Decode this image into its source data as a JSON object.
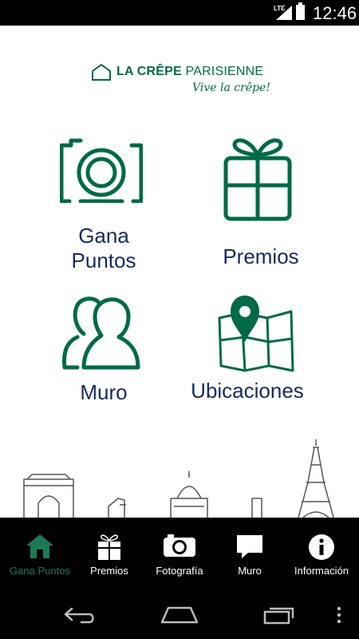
{
  "status_bar": {
    "network": "LTE",
    "time": "12:46",
    "icons": [
      "signal-icon",
      "battery-icon"
    ]
  },
  "logo": {
    "brand_bold": "LA CRÊPE",
    "brand_light": " PARISIENNE",
    "tagline": "Vive la crêpe!"
  },
  "tiles": {
    "gana": {
      "line1": "Gana",
      "line2": "Puntos",
      "icon": "camera-icon"
    },
    "premios": {
      "label": "Premios",
      "icon": "gift-icon"
    },
    "muro": {
      "label": "Muro",
      "icon": "users-icon"
    },
    "ubicaciones": {
      "label": "Ubicaciones",
      "icon": "map-pin-icon"
    }
  },
  "tab_bar": {
    "tabs": [
      {
        "label": "Gana Puntos",
        "icon": "home-icon",
        "active": true
      },
      {
        "label": "Premios",
        "icon": "gift-icon",
        "active": false
      },
      {
        "label": "Fotografía",
        "icon": "camera-icon",
        "active": false
      },
      {
        "label": "Muro",
        "icon": "chat-bubble-icon",
        "active": false
      },
      {
        "label": "Información",
        "icon": "info-icon",
        "active": false
      }
    ]
  },
  "nav_bar": {
    "buttons": [
      "back-icon",
      "home-icon",
      "recents-icon",
      "overflow-menu-icon"
    ]
  },
  "colors": {
    "brand_green": "#006a48",
    "label_navy": "#152a5c",
    "active_tab": "#1b7a55",
    "bar_background": "#000000"
  }
}
